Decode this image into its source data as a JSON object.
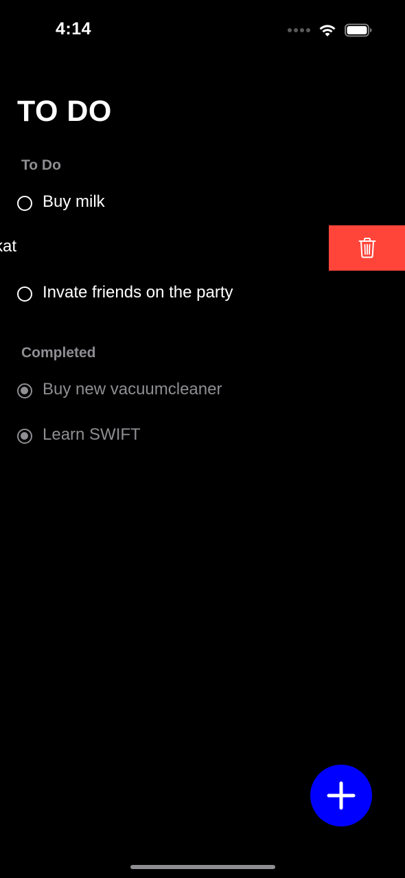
{
  "status_bar": {
    "time": "4:14",
    "icons": [
      "signal-dots-icon",
      "wifi-icon",
      "battery-icon"
    ]
  },
  "title": "TO DO",
  "sections": {
    "todo": {
      "header": "To Do",
      "items": [
        {
          "label": "Buy milk",
          "completed": false
        },
        {
          "label": "h kat",
          "completed": false,
          "swiped_open": true
        },
        {
          "label": "Invate friends on the party",
          "completed": false
        }
      ]
    },
    "completed": {
      "header": "Completed",
      "items": [
        {
          "label": "Buy new vacuumcleaner",
          "completed": true
        },
        {
          "label": "Learn SWIFT",
          "completed": true
        }
      ]
    }
  },
  "swipe_action": {
    "icon": "trash-icon",
    "color": "#ff453a"
  },
  "fab": {
    "icon": "plus-icon",
    "color": "#0000ff"
  },
  "colors": {
    "background": "#000000",
    "text": "#ffffff",
    "secondary_text": "#8e8e93"
  }
}
